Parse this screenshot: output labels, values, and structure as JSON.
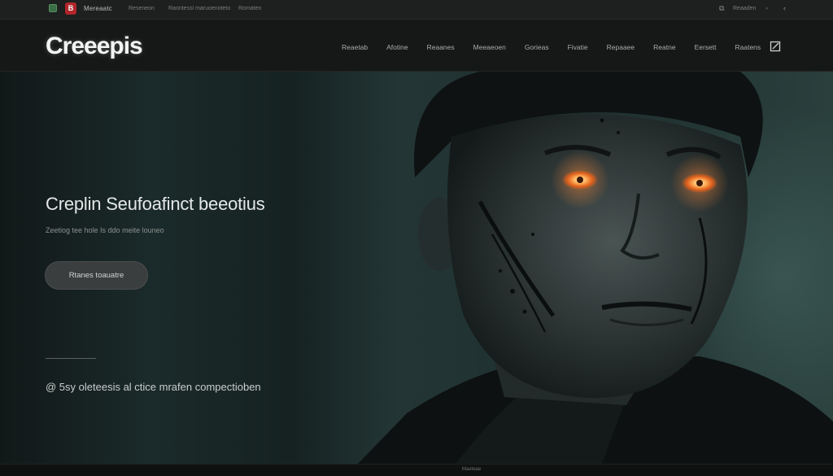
{
  "browser": {
    "tab_title": "Mereaatc",
    "tab_meta": [
      "Reseneon",
      "Raontessi maruoenoteto",
      "Romaten"
    ],
    "right_label": "Reaaden"
  },
  "header": {
    "logo": "Creeepis",
    "nav": [
      "Reaetab",
      "Afotine",
      "Reaanes",
      "Meeaeoen",
      "Gorieas",
      "Fivatie",
      "Repaaee",
      "Reatne",
      "Eersett",
      "Raatens"
    ]
  },
  "hero": {
    "title": "Creplin Seufoafinct beeotius",
    "subtitle": "Zeetiog tee hole Is ddo meite louneo",
    "button_label": "Rtanes toauatre",
    "note": "@ 5sy oleteesis al ctice mrafen compectioben"
  },
  "footer": {
    "text": "Maeteae"
  },
  "colors": {
    "background": "#0c0d0d",
    "header": "#161717",
    "accent_eye": "#ff8a3a",
    "button": "#3b3e3e"
  }
}
